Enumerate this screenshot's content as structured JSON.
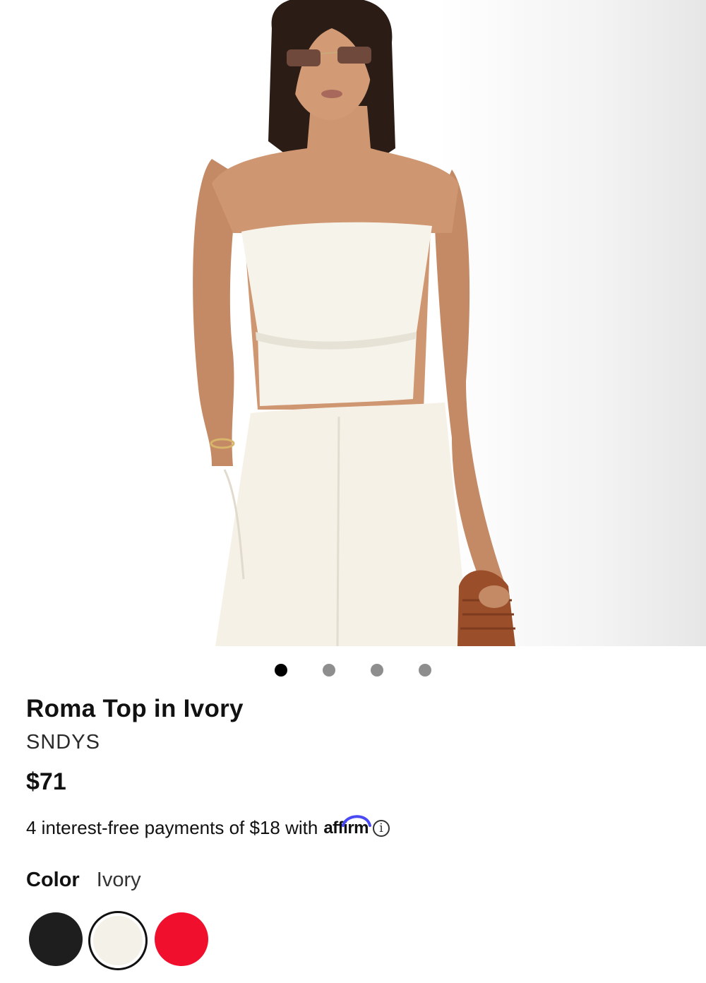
{
  "product": {
    "title": "Roma Top in Ivory",
    "brand": "SNDYS",
    "price": "$71"
  },
  "gallery": {
    "image_name": "product-photo",
    "slide_count": 4,
    "active_slide": 1
  },
  "financing": {
    "text": "4 interest-free payments of $18 with",
    "provider": "affirm",
    "info_icon": "info-icon"
  },
  "color": {
    "label": "Color",
    "selected": "Ivory",
    "swatches": [
      {
        "color": "#1e1e1e",
        "selected": false
      },
      {
        "color": "#f4f1e8",
        "selected": true
      },
      {
        "color": "#f0102e",
        "selected": false
      }
    ]
  },
  "colors": {
    "active_dot": "#000000",
    "inactive_dot": "#8e8e8e",
    "text": "#111111",
    "affirm_arc": "#4a4af4"
  }
}
